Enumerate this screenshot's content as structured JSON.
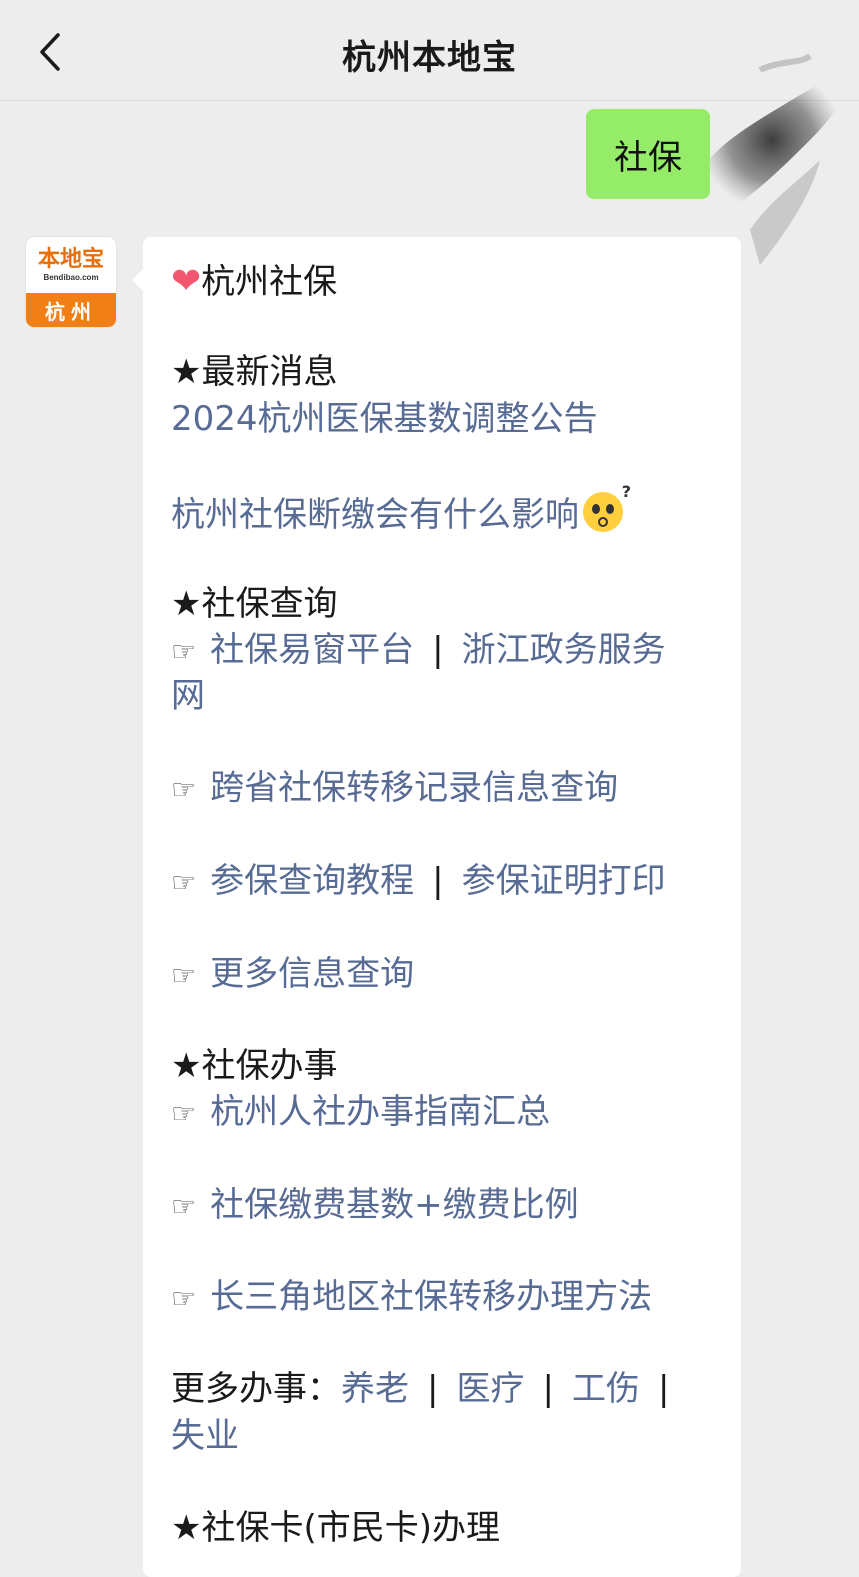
{
  "header": {
    "title": "杭州本地宝"
  },
  "user_message": "社保",
  "avatar": {
    "brand": "本地宝",
    "domain": "Bendibao.com",
    "city": "杭州"
  },
  "reply": {
    "title": "杭州社保",
    "section_news": "★最新消息",
    "news_link_1": "2024杭州医保基数调整公告",
    "news_link_2": "杭州社保断缴会有什么影响",
    "section_query": "★社保查询",
    "hand": "☞",
    "separator": "|",
    "query_link_1": "社保易窗平台",
    "query_link_2a": "浙江政务服务",
    "query_link_2b": "网",
    "query_link_3": "跨省社保转移记录信息查询",
    "query_link_4": "参保查询教程",
    "query_link_5": "参保证明打印",
    "query_link_6": "更多信息查询",
    "section_affairs": "★社保办事",
    "affairs_link_1": "杭州人社办事指南汇总",
    "affairs_link_2": "社保缴费基数+缴费比例",
    "affairs_link_3": "长三角地区社保转移办理方法",
    "more_label": "更多办事：",
    "more_1": "养老",
    "more_2": "医疗",
    "more_3": "工伤",
    "more_4": "失业",
    "section_card": "★社保卡(市民卡)办理"
  }
}
